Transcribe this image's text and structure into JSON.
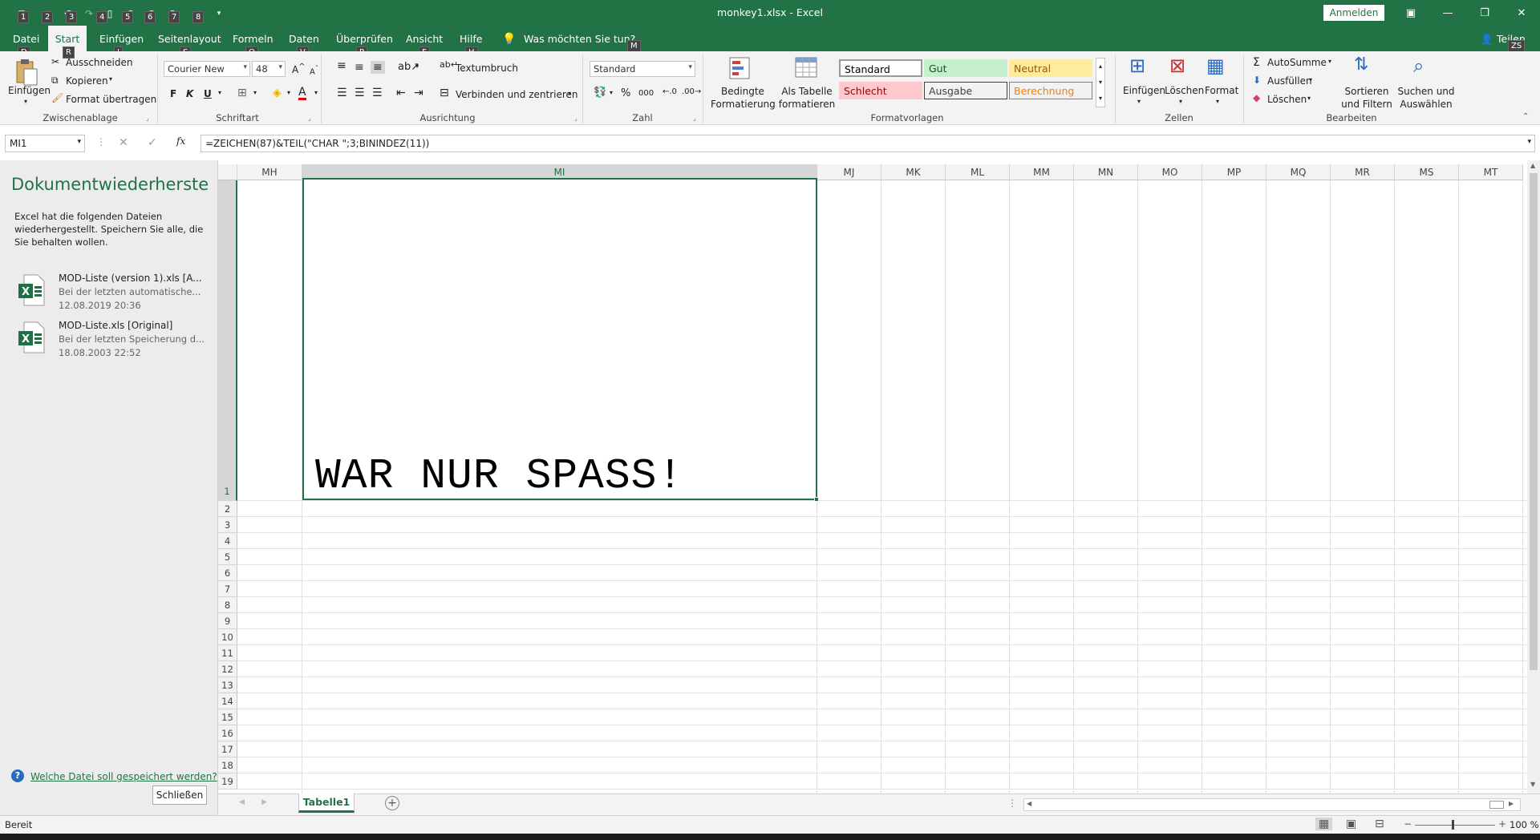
{
  "window": {
    "title": "monkey1.xlsx  -  Excel",
    "signin_label": "Anmelden",
    "qat_keytips": [
      "1",
      "2",
      "3",
      "4",
      "5",
      "6",
      "7",
      "8"
    ]
  },
  "tabs": [
    {
      "label": "Datei",
      "keytip": "D"
    },
    {
      "label": "Start",
      "keytip": "R"
    },
    {
      "label": "Einfügen",
      "keytip": "I"
    },
    {
      "label": "Seitenlayout",
      "keytip": "S"
    },
    {
      "label": "Formeln",
      "keytip": "O"
    },
    {
      "label": "Daten",
      "keytip": "V"
    },
    {
      "label": "Überprüfen",
      "keytip": "P"
    },
    {
      "label": "Ansicht",
      "keytip": "F"
    },
    {
      "label": "Hilfe",
      "keytip": "H"
    }
  ],
  "tell_me": {
    "label": "Was möchten Sie tun?",
    "keytip": "M"
  },
  "share": {
    "label": "Teilen",
    "keytip": "ZS"
  },
  "ribbon": {
    "clipboard": {
      "paste": "Einfügen",
      "cut": "Ausschneiden",
      "copy": "Kopieren",
      "format_painter": "Format übertragen",
      "group": "Zwischenablage"
    },
    "font": {
      "name": "Courier New",
      "size": "48",
      "bold": "F",
      "italic": "K",
      "underline": "U",
      "group": "Schriftart"
    },
    "alignment": {
      "wrap": "Textumbruch",
      "merge": "Verbinden und zentrieren",
      "group": "Ausrichtung"
    },
    "number": {
      "format": "Standard",
      "percent": "%",
      "thousands": "000",
      "group": "Zahl"
    },
    "styles": {
      "conditional": "Bedingte Formatierung",
      "as_table": "Als Tabelle formatieren",
      "cells": [
        {
          "label": "Standard",
          "bg": "#ffffff",
          "fg": "#000000",
          "border": "#9a9a9a"
        },
        {
          "label": "Gut",
          "bg": "#c6efce",
          "fg": "#006100",
          "border": "#c6efce"
        },
        {
          "label": "Neutral",
          "bg": "#ffeb9c",
          "fg": "#9c5700",
          "border": "#ffeb9c"
        },
        {
          "label": "Schlecht",
          "bg": "#ffc7ce",
          "fg": "#9c0006",
          "border": "#ffc7ce"
        },
        {
          "label": "Ausgabe",
          "bg": "#f2f2f2",
          "fg": "#3f3f3f",
          "border": "#3f3f3f"
        },
        {
          "label": "Berechnung",
          "bg": "#f2f2f2",
          "fg": "#fa7d00",
          "border": "#7f7f7f"
        }
      ],
      "group": "Formatvorlagen"
    },
    "cells_grp": {
      "insert": "Einfügen",
      "delete": "Löschen",
      "format": "Format",
      "group": "Zellen"
    },
    "editing": {
      "autosum": "AutoSumme",
      "fill": "Ausfüllen",
      "clear": "Löschen",
      "sort": "Sortieren und Filtern",
      "find": "Suchen und Auswählen",
      "group": "Bearbeiten"
    }
  },
  "formula_bar": {
    "name_box": "MI1",
    "formula": "=ZEICHEN(87)&TEIL(\"CHAR \";3;BININDEZ(11))"
  },
  "recovery": {
    "title": "Dokumentwiederherstell...",
    "text": "Excel hat die folgenden Dateien wiederhergestellt. Speichern Sie alle, die Sie behalten wollen.",
    "files": [
      {
        "name": "MOD-Liste (version 1).xls  [A...",
        "desc": "Bei der letzten automatische...",
        "date": "12.08.2019 20:36"
      },
      {
        "name": "MOD-Liste.xls  [Original]",
        "desc": "Bei der letzten Speicherung d...",
        "date": "18.08.2003 22:52"
      }
    ],
    "help_link": "Welche Datei soll gespeichert werden?",
    "close_label": "Schließen"
  },
  "grid": {
    "columns": [
      "MH",
      "MI",
      "MJ",
      "MK",
      "ML",
      "MM",
      "MN",
      "MO",
      "MP",
      "MQ",
      "MR",
      "MS",
      "MT"
    ],
    "rows": [
      "1",
      "2",
      "3",
      "4",
      "5",
      "6",
      "7",
      "8",
      "9",
      "10",
      "11",
      "12",
      "13",
      "14",
      "15",
      "16",
      "17",
      "18",
      "19"
    ],
    "cell_text": "WAR NUR SPASS!"
  },
  "sheet_tab": "Tabelle1",
  "status": {
    "ready": "Bereit",
    "zoom": "100 %"
  }
}
